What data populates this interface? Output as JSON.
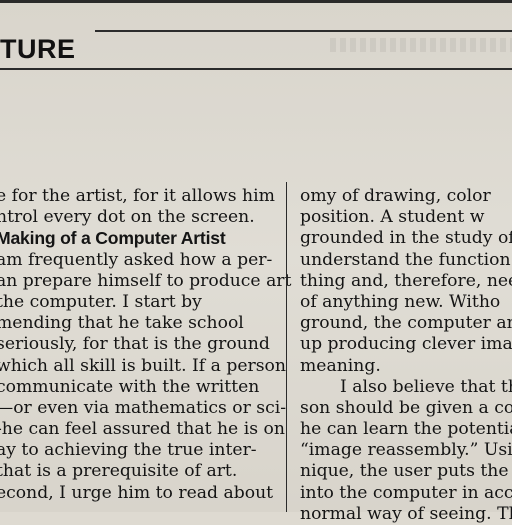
{
  "header": {
    "section_title": "TURE"
  },
  "left_column": {
    "lines_before_subhead": [
      "e for the artist, for it allows him",
      "ntrol every dot on the screen."
    ],
    "subhead": "Making of a Computer Artist",
    "lines_after_subhead": [
      "am frequently asked how a per-",
      "an prepare himself to produce art",
      "the computer. I start by",
      "mending that he take school",
      "seriously, for that is the ground",
      "which all skill is built. If a person",
      "communicate with the written",
      "—or even via mathematics or sci-",
      "-he can feel assured that he is on",
      "ay to achieving the true inter-",
      " that is a prerequisite of art.",
      "econd, I urge him to read about"
    ]
  },
  "right_column": {
    "lines": [
      "omy of drawing, color",
      "position. A student w",
      "grounded in the study of",
      "understand the function o",
      "thing and, therefore, need",
      "of anything new. Witho",
      "ground, the computer an",
      "up producing clever imag",
      "meaning.",
      "I also believe that th",
      "son should be given a com",
      "he can learn the potential",
      "“image reassembly.” Usi",
      "nique, the user puts the",
      "into the computer in acc",
      "normal way of seeing. The"
    ]
  }
}
